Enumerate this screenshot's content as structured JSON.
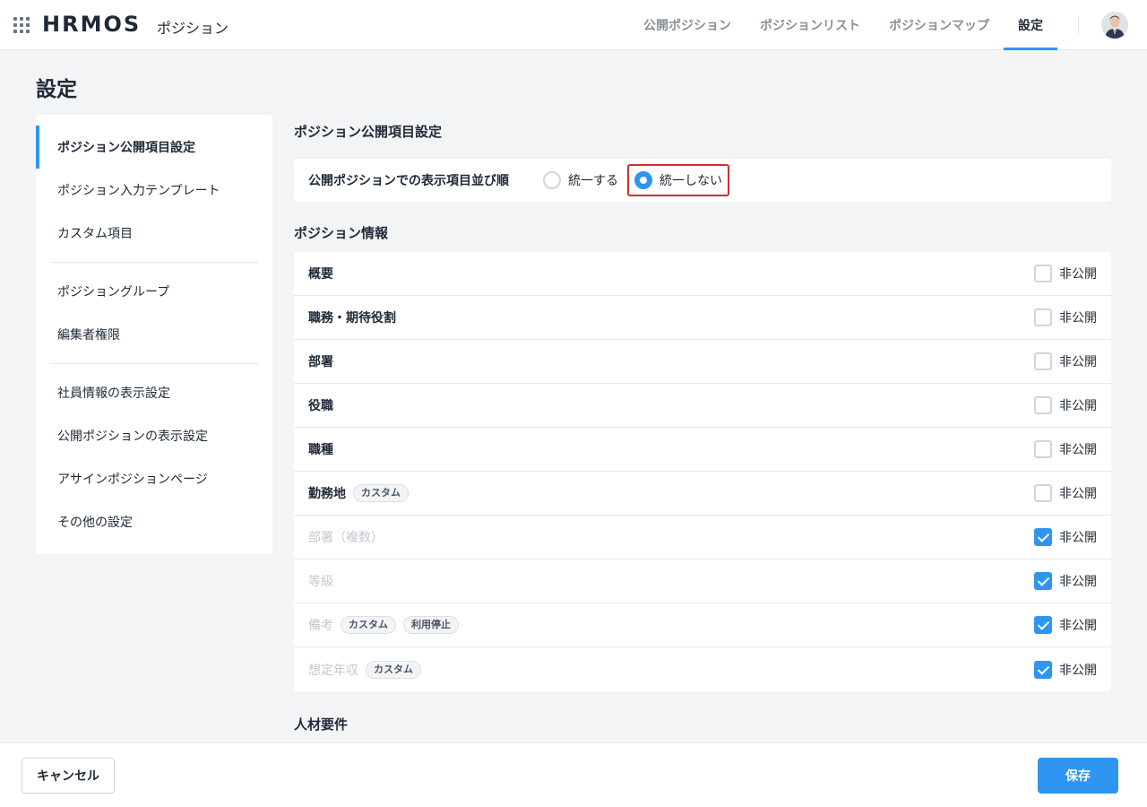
{
  "header": {
    "logo": "HRMOS",
    "app_name": "ポジション",
    "tabs": [
      {
        "label": "公開ポジション",
        "active": false
      },
      {
        "label": "ポジションリスト",
        "active": false
      },
      {
        "label": "ポジションマップ",
        "active": false
      },
      {
        "label": "設定",
        "active": true
      }
    ]
  },
  "page": {
    "title": "設定"
  },
  "sidebar": {
    "items": [
      {
        "label": "ポジション公開項目設定",
        "active": true
      },
      {
        "label": "ポジション入力テンプレート",
        "active": false
      },
      {
        "label": "カスタム項目",
        "active": false
      },
      {
        "label": "ポジショングループ",
        "active": false
      },
      {
        "label": "編集者権限",
        "active": false
      },
      {
        "label": "社員情報の表示設定",
        "active": false
      },
      {
        "label": "公開ポジションの表示設定",
        "active": false
      },
      {
        "label": "アサインポジションページ",
        "active": false
      },
      {
        "label": "その他の設定",
        "active": false
      }
    ]
  },
  "main": {
    "section_title": "ポジション公開項目設定",
    "order": {
      "label": "公開ポジションでの表示項目並び順",
      "options": [
        {
          "label": "統一する",
          "checked": false
        },
        {
          "label": "統一しない",
          "checked": true
        }
      ]
    },
    "position_info_title": "ポジション情報",
    "hidden_label": "非公開",
    "rows": [
      {
        "label": "概要",
        "tags": [],
        "disabled": false,
        "hidden": false
      },
      {
        "label": "職務・期待役割",
        "tags": [],
        "disabled": false,
        "hidden": false
      },
      {
        "label": "部署",
        "tags": [],
        "disabled": false,
        "hidden": false
      },
      {
        "label": "役職",
        "tags": [],
        "disabled": false,
        "hidden": false
      },
      {
        "label": "職種",
        "tags": [],
        "disabled": false,
        "hidden": false
      },
      {
        "label": "勤務地",
        "tags": [
          "カスタム"
        ],
        "disabled": false,
        "hidden": false
      },
      {
        "label": "部署（複数）",
        "tags": [],
        "disabled": true,
        "hidden": true
      },
      {
        "label": "等級",
        "tags": [],
        "disabled": true,
        "hidden": true
      },
      {
        "label": "備考",
        "tags": [
          "カスタム",
          "利用停止"
        ],
        "disabled": true,
        "hidden": true
      },
      {
        "label": "想定年収",
        "tags": [
          "カスタム"
        ],
        "disabled": true,
        "hidden": true
      }
    ],
    "talent_title": "人材要件"
  },
  "footer": {
    "cancel_label": "キャンセル",
    "save_label": "保存"
  },
  "colors": {
    "accent": "#2f95f0",
    "highlight": "#d32f2f"
  }
}
